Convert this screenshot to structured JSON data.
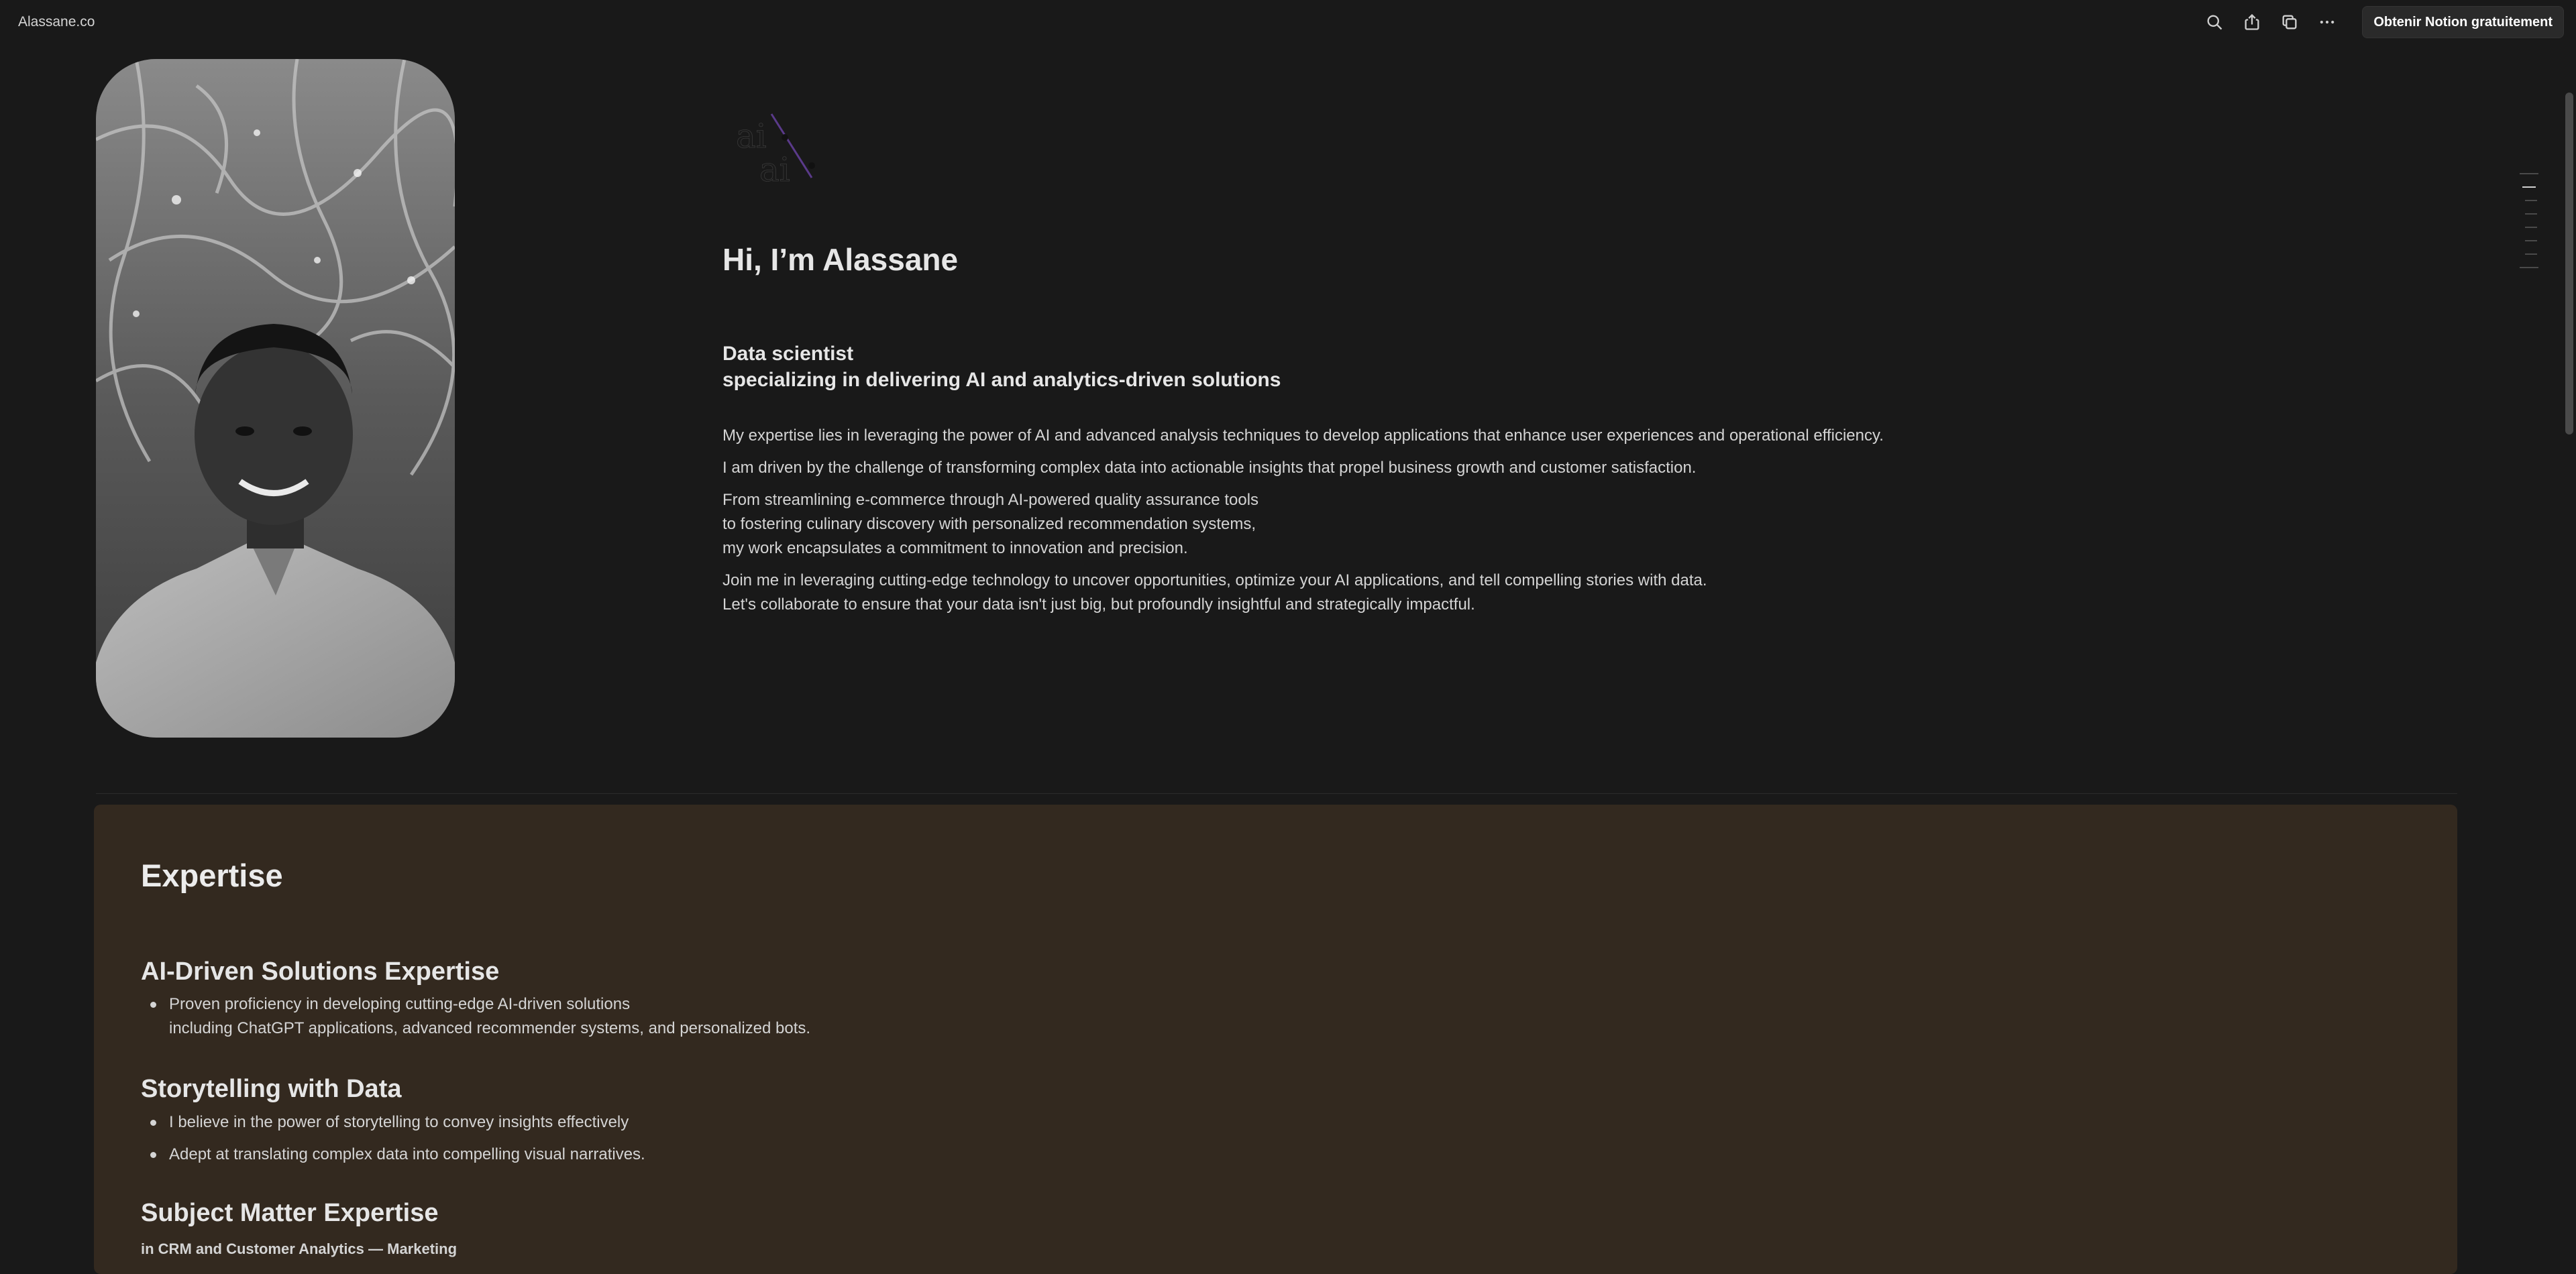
{
  "topbar": {
    "site_title": "Alassane.co",
    "cta_label": "Obtenir Notion gratuitement",
    "icons": [
      "search-icon",
      "share-icon",
      "duplicate-icon",
      "more-icon"
    ]
  },
  "hero": {
    "title": "Hi, I’m Alassane",
    "role_line1": "Data scientist",
    "role_line2": "specializing in delivering AI and analytics-driven solutions",
    "paragraphs": [
      [
        "My expertise lies in leveraging the power of AI and advanced analysis techniques to develop applications that enhance user experiences and operational efficiency."
      ],
      [
        "I am driven by the challenge of transforming complex data into actionable insights that propel business growth and customer satisfaction."
      ],
      [
        "From streamlining e-commerce through AI-powered quality assurance tools",
        "to fostering culinary discovery with personalized recommendation systems,",
        "my work encapsulates a commitment to innovation and precision."
      ],
      [
        "Join me in leveraging cutting-edge technology to uncover opportunities, optimize your AI applications, and tell compelling stories with data.",
        "Let's collaborate to ensure that your data isn't just big, but profoundly insightful and strategically impactful."
      ]
    ],
    "logo_text": [
      "ai",
      "ai"
    ]
  },
  "expertise": {
    "title": "Expertise",
    "sections": [
      {
        "heading": "AI-Driven Solutions Expertise",
        "bullets": [
          [
            "Proven proficiency in developing cutting-edge AI-driven solutions",
            "including ChatGPT applications, advanced recommender systems, and personalized bots."
          ]
        ]
      },
      {
        "heading": "Storytelling with Data",
        "bullets": [
          [
            "I believe in the power of storytelling to convey insights effectively"
          ],
          [
            "Adept at translating complex data into compelling visual narratives."
          ]
        ]
      },
      {
        "heading": "Subject Matter Expertise",
        "bullets": []
      }
    ],
    "subject_line": "in CRM and Customer Analytics — Marketing"
  },
  "colors": {
    "background": "#191919",
    "callout_bg": "#33291f",
    "text": "#d4d4d4"
  }
}
